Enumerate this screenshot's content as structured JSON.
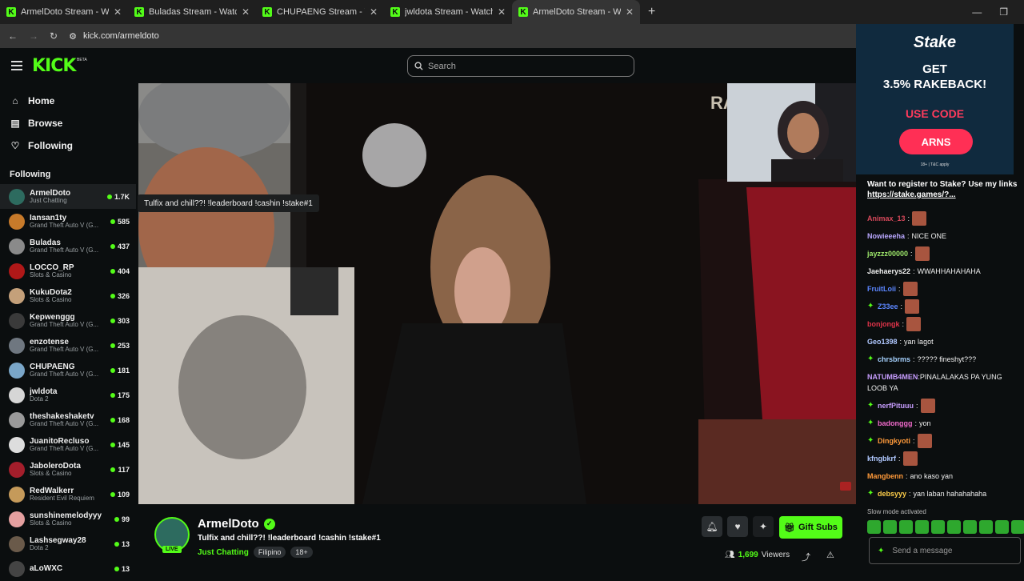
{
  "browser": {
    "tabs": [
      {
        "title": "ArmelDoto Stream - Watch Live",
        "active": false
      },
      {
        "title": "Buladas Stream - Watch Live on",
        "active": false
      },
      {
        "title": "CHUPAENG Stream - Watch Live",
        "active": false
      },
      {
        "title": "jwldota Stream - Watch Live on",
        "active": false
      },
      {
        "title": "ArmelDoto Stream - Watch",
        "active": true
      }
    ],
    "url": "kick.com/armeldoto"
  },
  "header": {
    "logo": "KICK",
    "beta": "BETA",
    "search_placeholder": "Search"
  },
  "sidebar": {
    "nav": [
      {
        "label": "Home",
        "icon": "home-icon"
      },
      {
        "label": "Browse",
        "icon": "browse-icon"
      },
      {
        "label": "Following",
        "icon": "heart-icon"
      }
    ],
    "following_heading": "Following",
    "channels": [
      {
        "name": "ArmelDoto",
        "category": "Just Chatting",
        "viewers": "1.7K",
        "color": "#2d6b5f"
      },
      {
        "name": "Iansan1ty",
        "category": "Grand Theft Auto V (G...",
        "viewers": "585",
        "color": "#c77a2a"
      },
      {
        "name": "Buladas",
        "category": "Grand Theft Auto V (G...",
        "viewers": "437",
        "color": "#8a8a8a"
      },
      {
        "name": "LOCCO_RP",
        "category": "Slots & Casino",
        "viewers": "404",
        "color": "#b01818"
      },
      {
        "name": "KukuDota2",
        "category": "Slots & Casino",
        "viewers": "326",
        "color": "#c4a07a"
      },
      {
        "name": "Kepwenggg",
        "category": "Grand Theft Auto V (G...",
        "viewers": "303",
        "color": "#3a3a3a"
      },
      {
        "name": "enzotense",
        "category": "Grand Theft Auto V (G...",
        "viewers": "253",
        "color": "#6f7780"
      },
      {
        "name": "CHUPAENG",
        "category": "Grand Theft Auto V (G...",
        "viewers": "181",
        "color": "#7aa6c8"
      },
      {
        "name": "jwldota",
        "category": "Dota 2",
        "viewers": "175",
        "color": "#d6d6d6"
      },
      {
        "name": "theshakeshaketv",
        "category": "Grand Theft Auto V (G...",
        "viewers": "168",
        "color": "#9a9a9a"
      },
      {
        "name": "JuanitoRecluso",
        "category": "Grand Theft Auto V (G...",
        "viewers": "145",
        "color": "#ddd"
      },
      {
        "name": "JaboleroDota",
        "category": "Slots & Casino",
        "viewers": "117",
        "color": "#a41e2b"
      },
      {
        "name": "RedWalkerr",
        "category": "Resident Evil Requiem",
        "viewers": "109",
        "color": "#c59a5a"
      },
      {
        "name": "sunshinemelodyyy",
        "category": "Slots & Casino",
        "viewers": "99",
        "color": "#e5a0a0"
      },
      {
        "name": "Lashsegway28",
        "category": "Dota 2",
        "viewers": "13",
        "color": "#6a5a4a"
      },
      {
        "name": "aLoWXC",
        "category": "",
        "viewers": "13",
        "color": "#444"
      }
    ]
  },
  "video": {
    "tooltip": "Tulfix and chill??! !leaderboard !cashin !stake#1",
    "overlay_text": "RA"
  },
  "stream": {
    "name": "ArmelDoto",
    "live_badge": "LIVE",
    "title": "Tulfix and chill??! !leaderboard !cashin !stake#1",
    "category": "Just Chatting",
    "tags": [
      "Filipino",
      "18+"
    ],
    "gift_label": "Gift Subs",
    "viewers_count": "1,699",
    "viewers_label": "Viewers"
  },
  "chat": {
    "ad": {
      "brand": "Stake",
      "line1": "GET",
      "line2": "3.5% RAKEBACK!",
      "code_label": "USE CODE",
      "code": "ARNS",
      "tc": "18+ | T&C apply"
    },
    "pinned_text": "Want to register to Stake? Use my links",
    "pinned_link": "https://stake.games/?...",
    "messages": [
      {
        "user": "Animax_13",
        "color": "#d6485a",
        "text": "",
        "emote": true,
        "badge": false
      },
      {
        "user": "Nowieeeha",
        "color": "#b9a8ff",
        "text": "NICE ONE",
        "emote": false,
        "badge": false
      },
      {
        "user": "jayzzz00000",
        "color": "#9ee86b",
        "text": "",
        "emote": true,
        "badge": false
      },
      {
        "user": "Jaehaerys22",
        "color": "#f0f0f0",
        "text": "WWAHHAHAHAHA",
        "emote": false,
        "badge": false
      },
      {
        "user": "FruitLoii",
        "color": "#5b86ff",
        "text": "",
        "emote": true,
        "badge": false
      },
      {
        "user": "Z33ee",
        "color": "#5b86ff",
        "text": "",
        "emote": true,
        "badge": true
      },
      {
        "user": "bonjongk",
        "color": "#e0344a",
        "text": "",
        "emote": true,
        "badge": false
      },
      {
        "user": "Geo1398",
        "color": "#b0c8ff",
        "text": "yan lagot",
        "emote": false,
        "badge": false
      },
      {
        "user": "chrsbrms",
        "color": "#a6d2ff",
        "text": "????? fineshyt???",
        "emote": false,
        "badge": true
      },
      {
        "user": "NATUMB4MEN",
        "color": "#c89eff",
        "text": "PINALALAKAS PA YUNG LOOB YA",
        "emote": false,
        "badge": false,
        "wrap": true
      },
      {
        "user": "nerfPituuu",
        "color": "#c89eff",
        "text": "",
        "emote": true,
        "badge": true
      },
      {
        "user": "badonggg",
        "color": "#f06acb",
        "text": "yon",
        "emote": false,
        "badge": true
      },
      {
        "user": "Dingkyoti",
        "color": "#ff9a3a",
        "text": "",
        "emote": true,
        "badge": true
      },
      {
        "user": "kfngbkrf",
        "color": "#b0c8ff",
        "text": "",
        "emote": true,
        "badge": false
      },
      {
        "user": "Mangbenn",
        "color": "#ff9a3a",
        "text": "ano kaso yan",
        "emote": false,
        "badge": false
      },
      {
        "user": "debsyyy",
        "color": "#ffcf4a",
        "text": "yan laban hahahahaha",
        "emote": false,
        "badge": true
      }
    ],
    "slow_mode": "Slow mode activated",
    "input_placeholder": "Send a message"
  },
  "colors": {
    "accent": "#53fc18",
    "background": "#0b0e0f",
    "ad_accent": "#ff2f55"
  }
}
